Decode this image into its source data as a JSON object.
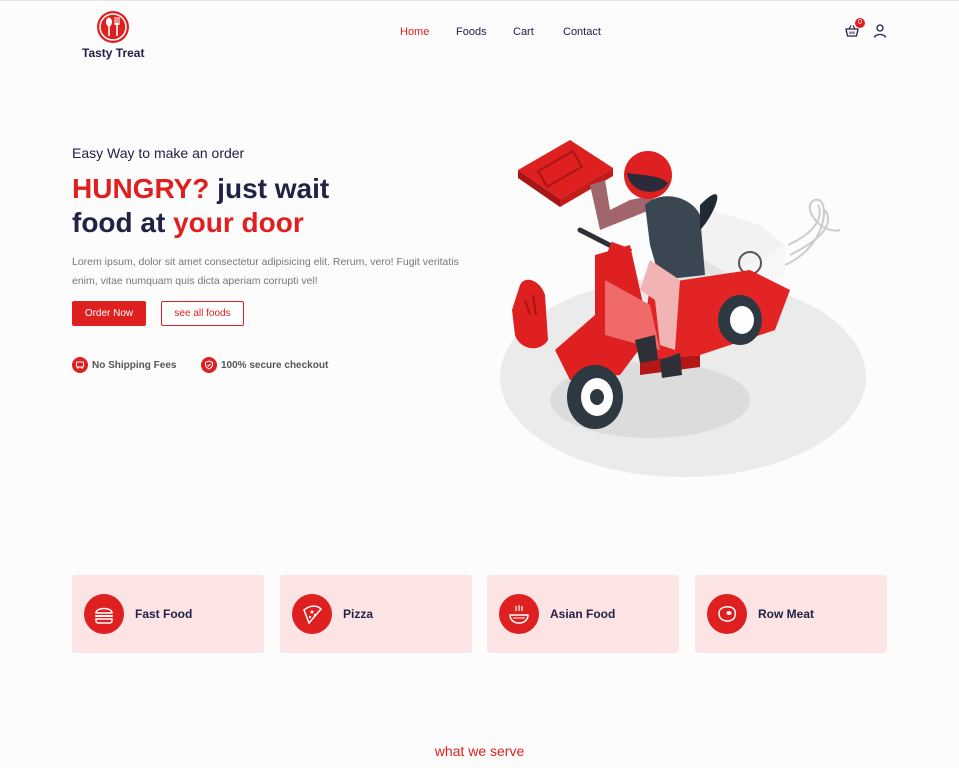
{
  "brand": {
    "name": "Tasty Treat",
    "logo_icon": "spoon-fork-icon",
    "color": "#df2020"
  },
  "nav": {
    "items": [
      {
        "label": "Home",
        "active": true
      },
      {
        "label": "Foods",
        "active": false
      },
      {
        "label": "Cart",
        "active": false
      },
      {
        "label": "Contact",
        "active": false
      }
    ]
  },
  "header": {
    "cart_count": "0",
    "cart_icon": "shopping-basket-icon",
    "user_icon": "user-icon"
  },
  "hero": {
    "subtitle": "Easy Way to make an order",
    "title_part1": "HUNGRY?",
    "title_part2": " just wait",
    "title_part3": "food at ",
    "title_part4": "your door",
    "description": "Lorem ipsum, dolor sit amet consectetur adipisicing elit. Rerum, vero! Fugit veritatis enim, vitae numquam quis dicta aperiam corrupti vel!",
    "order_button": "Order Now",
    "all_foods_button": "see all foods",
    "features": [
      {
        "label": "No Shipping Fees",
        "icon": "delivery-car-icon"
      },
      {
        "label": "100% secure checkout",
        "icon": "shield-check-icon"
      }
    ],
    "illustration": "pizza-delivery-scooter-illustration"
  },
  "categories": [
    {
      "label": "Fast Food",
      "icon": "burger-icon"
    },
    {
      "label": "Pizza",
      "icon": "pizza-slice-icon"
    },
    {
      "label": "Asian Food",
      "icon": "noodle-bowl-icon"
    },
    {
      "label": "Row Meat",
      "icon": "steak-icon"
    }
  ],
  "section_title": "what we serve"
}
